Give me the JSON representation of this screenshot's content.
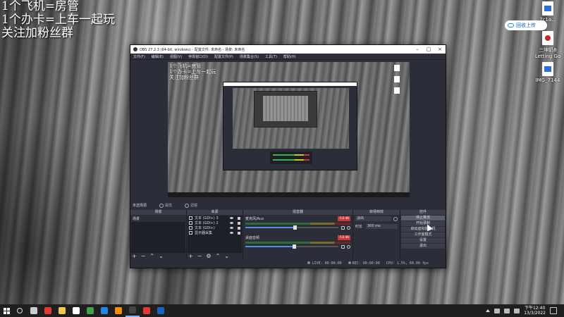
{
  "overlay": {
    "line1": "1个飞机=房管",
    "line2": "1个办卡=上车一起玩",
    "line3": "关注加粉丝群"
  },
  "desktop_icons": [
    {
      "label": "7c1a...",
      "icon": "document-icon"
    },
    {
      "label": "三坤奶8 Letting Go",
      "icon": "pdf-icon"
    },
    {
      "label": "IMG_7144",
      "icon": "document-icon"
    }
  ],
  "cloud_button": {
    "label": "回收上传",
    "icon": "cloud-icon"
  },
  "obs": {
    "title": "OBS 27.2.3 (64-bit, windows) - 配置文件: 未命名 - 场景: 未命名",
    "menu": [
      "文件(F)",
      "编辑(E)",
      "视图(V)",
      "停靠窗口(D)",
      "配置文件(P)",
      "场景集合(S)",
      "工具(T)",
      "帮助(H)"
    ],
    "controls_bar": {
      "source_label": "未选择源",
      "properties": "属性",
      "filters": "滤镜"
    },
    "docks": {
      "scenes": {
        "title": "场景",
        "items": [
          "场景"
        ]
      },
      "sources": {
        "title": "来源",
        "items": [
          "文本 (GDI+) 3",
          "文本 (GDI+) 2",
          "文本 (GDI+)",
          "显示器采集"
        ]
      },
      "mixer": {
        "title": "混音器",
        "channels": [
          {
            "name": "麦克风/Aux",
            "db": "-5.0 dB",
            "level": 0.53
          },
          {
            "name": "桌面音频",
            "db": "-5.0 dB",
            "level": 0.52
          }
        ]
      },
      "transitions": {
        "title": "转场特效",
        "mode": "淡出",
        "duration_label": "时长",
        "duration": "300 ms"
      },
      "controls": {
        "title": "控件",
        "buttons": [
          "停止推流",
          "开始录制",
          "启动虚拟摄像机",
          "工作室模式",
          "设置",
          "退出"
        ]
      }
    },
    "status": {
      "live": "LIVE: 00:00:00",
      "rec": "REC: 00:00:00",
      "cpu": "CPU: 1.5%, 60.00 fps"
    }
  },
  "taskbar": {
    "clock_time": "下午12:40",
    "clock_date": "13/3/2022",
    "icons": [
      {
        "name": "search-icon",
        "color": "#dddddd"
      },
      {
        "name": "task-view-icon",
        "color": "#cccccc"
      },
      {
        "name": "app-red-icon",
        "color": "#e53935"
      },
      {
        "name": "file-explorer-icon",
        "color": "#f2c94c"
      },
      {
        "name": "store-icon",
        "color": "#ffffff"
      },
      {
        "name": "xbox-icon",
        "color": "#43a047"
      },
      {
        "name": "edge-icon",
        "color": "#1e88e5"
      },
      {
        "name": "app-orange-icon",
        "color": "#fb8c00"
      },
      {
        "name": "obs-icon",
        "color": "#444444"
      },
      {
        "name": "camera-app-icon",
        "color": "#e53935"
      },
      {
        "name": "outlook-icon",
        "color": "#1565c0"
      }
    ]
  }
}
